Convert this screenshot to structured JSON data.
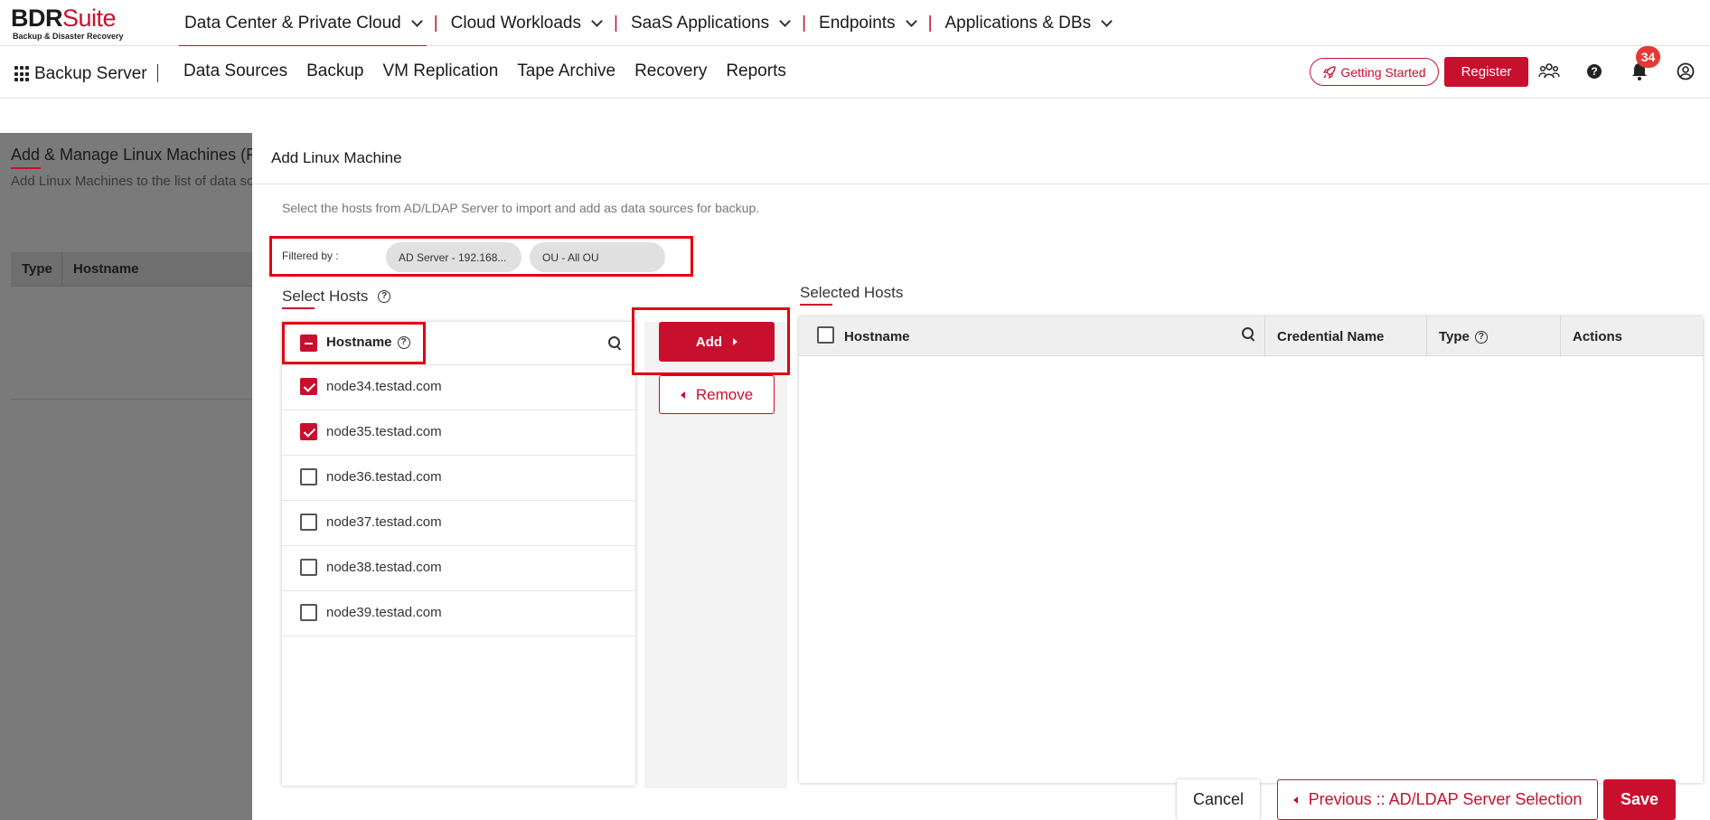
{
  "app": {
    "logo_main_1": "BDR",
    "logo_main_2": "Suite",
    "logo_sub": "Backup & Disaster Recovery"
  },
  "topnav": {
    "items": [
      "Data Center & Private Cloud",
      "Cloud Workloads",
      "SaaS Applications",
      "Endpoints",
      "Applications & DBs"
    ],
    "separator": "|"
  },
  "subnav": {
    "apps_label": "Backup Server",
    "items": [
      "Data Sources",
      "Backup",
      "VM Replication",
      "Tape Archive",
      "Recovery",
      "Reports"
    ],
    "getting_started": "Getting Started",
    "register": "Register",
    "notifications_count": "34"
  },
  "background_page": {
    "title": "Add & Manage Linux Machines (File",
    "description": "Add Linux Machines to the list of data sou",
    "columns": [
      "Type",
      "Hostname"
    ]
  },
  "modal": {
    "title": "Add Linux Machine",
    "description": "Select the hosts from AD/LDAP Server to import and add as data sources for backup.",
    "filter": {
      "label": "Filtered by :",
      "chips": [
        "AD Server - 192.168...",
        "OU - All OU"
      ]
    },
    "select_hosts": {
      "title": "Select Hosts",
      "column": "Hostname",
      "rows": [
        {
          "hostname": "node34.testad.com",
          "checked": true
        },
        {
          "hostname": "node35.testad.com",
          "checked": true
        },
        {
          "hostname": "node36.testad.com",
          "checked": false
        },
        {
          "hostname": "node37.testad.com",
          "checked": false
        },
        {
          "hostname": "node38.testad.com",
          "checked": false
        },
        {
          "hostname": "node39.testad.com",
          "checked": false
        }
      ]
    },
    "add_label": "Add",
    "remove_label": "Remove",
    "selected_hosts": {
      "title": "Selected Hosts",
      "columns": [
        "Hostname",
        "Credential Name",
        "Type",
        "Actions"
      ]
    },
    "footer": {
      "cancel": "Cancel",
      "previous": "Previous :: AD/LDAP Server Selection",
      "save": "Save"
    }
  },
  "colors": {
    "accent": "#c8102e",
    "highlight_box": "#e3000f"
  }
}
